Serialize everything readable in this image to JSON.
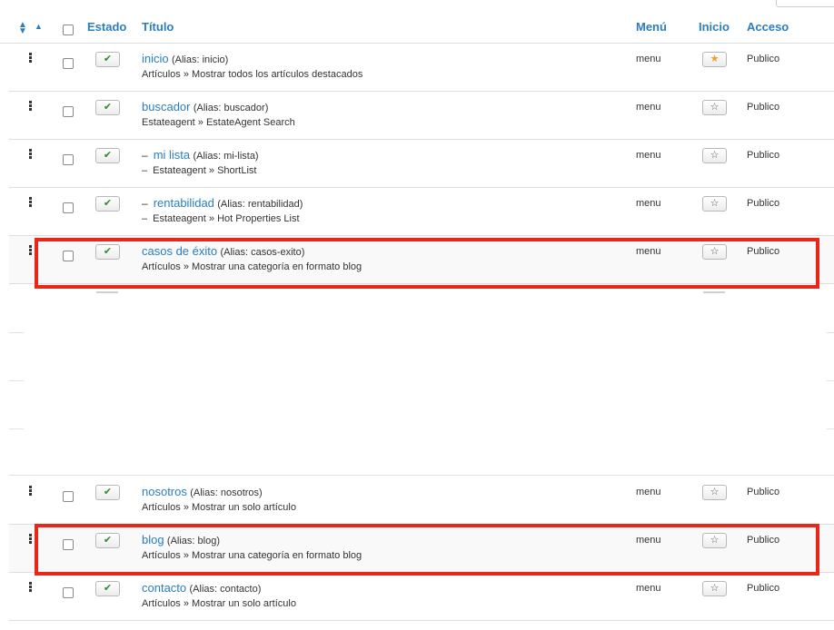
{
  "header": {
    "estado": "Estado",
    "titulo": "Título",
    "menu": "Menú",
    "inicio": "Inicio",
    "acceso": "Acceso"
  },
  "icons": {
    "sort": "sort-both-icon",
    "sort_asc": "sort-ascending-icon",
    "check": "check-icon",
    "star": "star-icon",
    "drag": "drag-handle-icon"
  },
  "colors": {
    "link": "#2a7ec0",
    "check": "#2f8a2f",
    "star_active": "#e8a02a",
    "highlight": "#e8261a"
  },
  "rows": [
    {
      "title": "inicio",
      "alias": "(Alias: inicio)",
      "sub": "Artículos » Mostrar todos los artículos destacados",
      "menu": "menu",
      "home": "★",
      "access": "Publico",
      "child": false
    },
    {
      "title": "buscador",
      "alias": "(Alias: buscador)",
      "sub": "Estateagent » EstateAgent Search",
      "menu": "menu",
      "home": "☆",
      "access": "Publico",
      "child": false
    },
    {
      "title": "mi lista",
      "alias": "(Alias: mi-lista)",
      "sub": "Estateagent » ShortList",
      "menu": "menu",
      "home": "☆",
      "access": "Publico",
      "child": true
    },
    {
      "title": "rentabilidad",
      "alias": "(Alias: rentabilidad)",
      "sub": "Estateagent » Hot Properties List",
      "menu": "menu",
      "home": "☆",
      "access": "Publico",
      "child": true
    },
    {
      "title": "casos de éxito",
      "alias": "(Alias: casos-exito)",
      "sub": "Artículos » Mostrar una categoría en formato blog",
      "menu": "menu",
      "home": "☆",
      "access": "Publico",
      "child": false
    },
    {
      "title": "nosotros",
      "alias": "(Alias: nosotros)",
      "sub": "Artículos » Mostrar un solo artículo",
      "menu": "menu",
      "home": "☆",
      "access": "Publico",
      "child": false
    },
    {
      "title": "blog",
      "alias": "(Alias: blog)",
      "sub": "Artículos » Mostrar una categoría en formato blog",
      "menu": "menu",
      "home": "☆",
      "access": "Publico",
      "child": false
    },
    {
      "title": "contacto",
      "alias": "(Alias: contacto)",
      "sub": "Artículos » Mostrar un solo artículo",
      "menu": "menu",
      "home": "☆",
      "access": "Publico",
      "child": false
    }
  ],
  "check_glyph": "✔",
  "child_dash": "–"
}
